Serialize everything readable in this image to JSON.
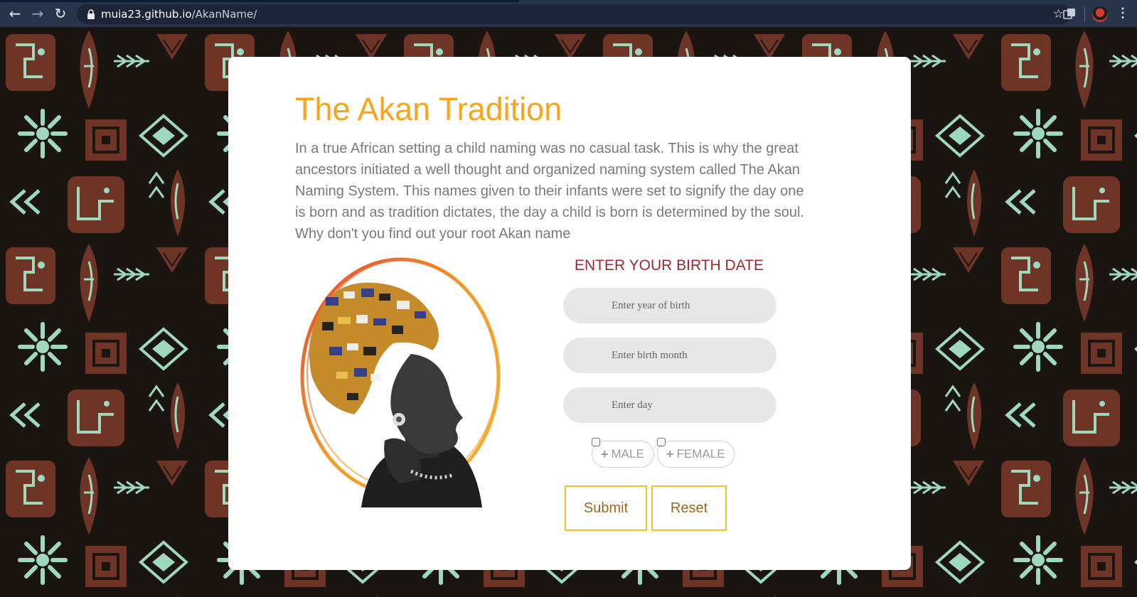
{
  "browser": {
    "url_host": "muia23.github.io",
    "url_path": "/AkanName/"
  },
  "page": {
    "title": "The Akan Tradition",
    "intro": "In a true African setting a child naming was no casual task. This is why the great ancestors initiated a well thought and organized naming system called The Akan Naming System. This names given to their infants were set to signify the day one is born and as tradition dictates, the day a child is born is determined by the soul. Why don't you find out your root Akan name"
  },
  "form": {
    "heading": "ENTER YOUR BIRTH DATE",
    "year_placeholder": "Enter year of birth",
    "month_placeholder": "Enter birth month",
    "day_placeholder": "Enter day",
    "male_label": "MALE",
    "female_label": "FEMALE",
    "submit_label": "Submit",
    "reset_label": "Reset"
  },
  "colors": {
    "title": "#f7a51a",
    "heading": "#a0282a",
    "button_border": "#f7bd2b",
    "pattern_brown": "#6e3526",
    "pattern_mint": "#9fd9bd",
    "pattern_dark": "#1b1512"
  },
  "icons": [
    "back-arrow-icon",
    "forward-arrow-icon",
    "reload-icon",
    "lock-icon",
    "star-icon",
    "extensions-icon",
    "profile-avatar",
    "kebab-menu-icon"
  ]
}
